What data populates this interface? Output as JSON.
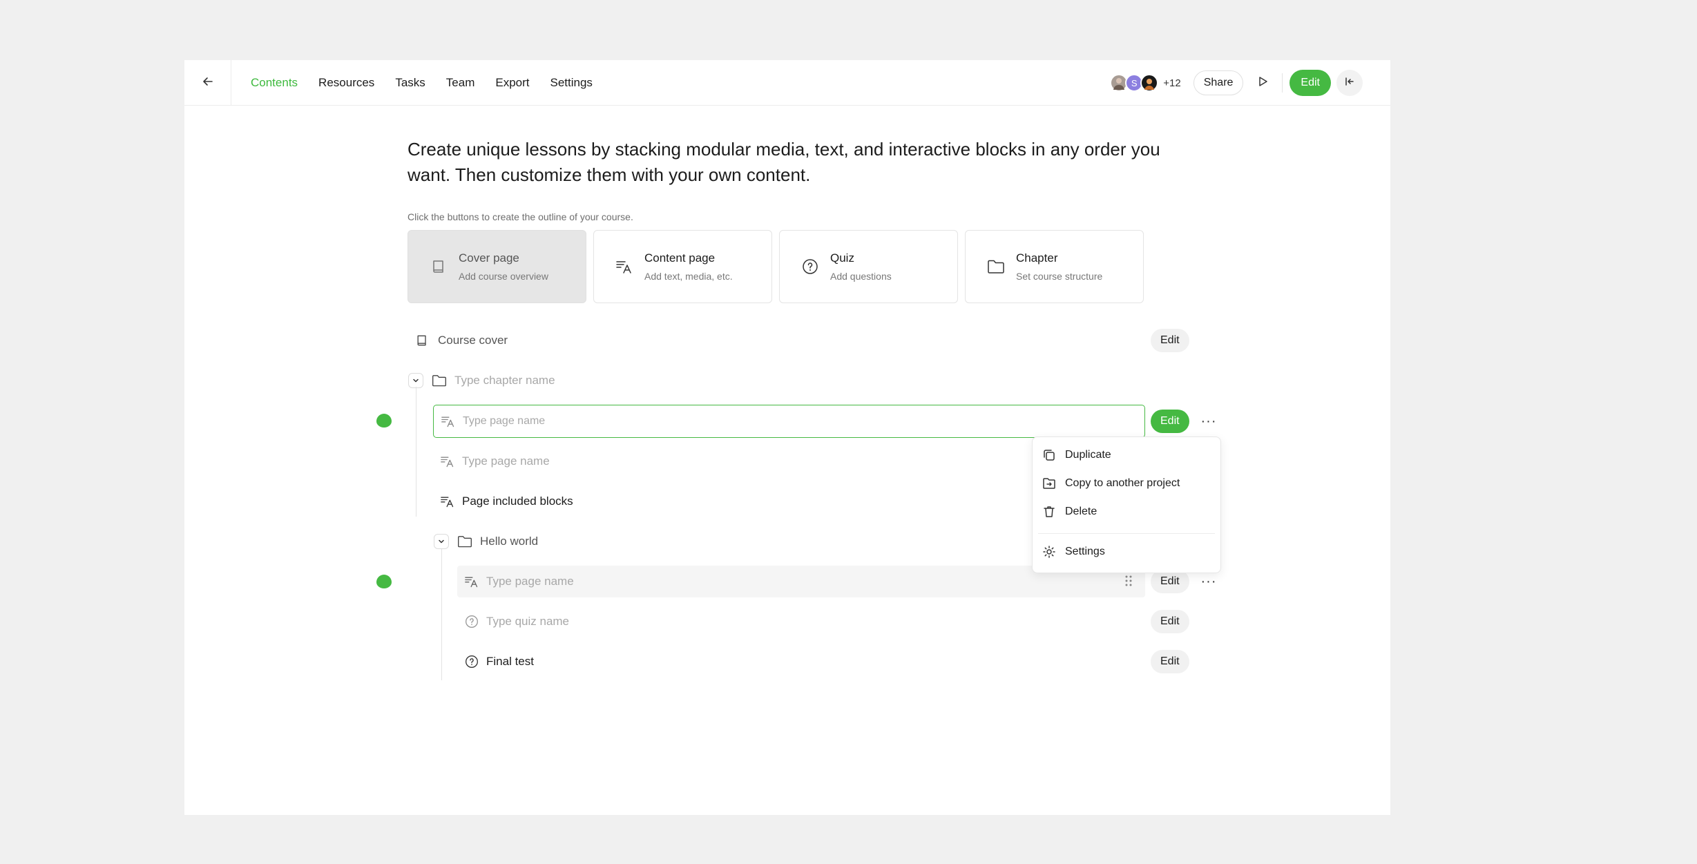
{
  "nav": {
    "tabs": [
      "Contents",
      "Resources",
      "Tasks",
      "Team",
      "Export",
      "Settings"
    ],
    "active": "Contents"
  },
  "toolbar": {
    "avatar_letter": "S",
    "extra_collaborators": "+12",
    "share_label": "Share",
    "edit_label": "Edit"
  },
  "intro": {
    "headline": "Create unique lessons by stacking modular media, text, and interactive blocks in any order you want. Then customize them with your own content.",
    "hint": "Click the buttons to create the outline of your course."
  },
  "cards": [
    {
      "title": "Cover page",
      "subtitle": "Add course overview",
      "icon": "book-icon",
      "disabled": true
    },
    {
      "title": "Content page",
      "subtitle": "Add text, media, etc.",
      "icon": "text-icon",
      "disabled": false
    },
    {
      "title": "Quiz",
      "subtitle": "Add questions",
      "icon": "question-icon",
      "disabled": false
    },
    {
      "title": "Chapter",
      "subtitle": "Set course structure",
      "icon": "folder-icon",
      "disabled": false
    }
  ],
  "outline": {
    "cover_label": "Course cover",
    "chapter_placeholder": "Type chapter name",
    "page_placeholder": "Type page name",
    "page_placeholder_2": "Type page name",
    "page_included_blocks": "Page included blocks",
    "sub_chapter": "Hello world",
    "sub_page_placeholder": "Type page name",
    "quiz_placeholder": "Type quiz name",
    "final_test": "Final test",
    "edit_label": "Edit"
  },
  "context_menu": {
    "items": [
      "Duplicate",
      "Copy to another project",
      "Delete"
    ],
    "settings": "Settings"
  },
  "colors": {
    "accent": "#45b942",
    "active_tab": "#3db93d",
    "background": "#f0f0f0",
    "panel": "#ffffff"
  }
}
